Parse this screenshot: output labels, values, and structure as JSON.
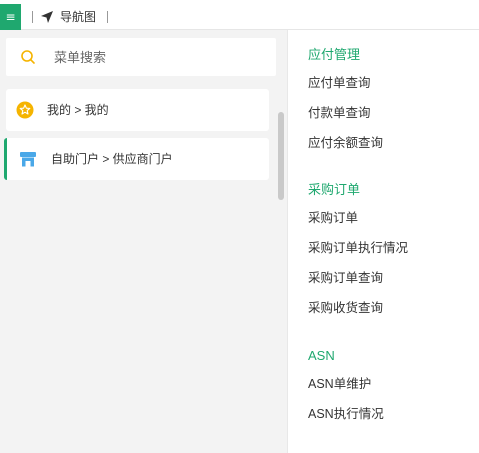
{
  "topbar": {
    "menu_icon": "hamburger-icon",
    "nav_icon": "navigation-arrow-icon",
    "title": "导航图"
  },
  "search": {
    "icon": "search-icon",
    "placeholder": "菜单搜索"
  },
  "favorites": [
    {
      "icon": "star-badge-icon",
      "label": "我的 > 我的"
    },
    {
      "icon": "storefront-icon",
      "label": "自助门户 > 供应商门户"
    }
  ],
  "menu_groups": [
    {
      "title": "应付管理",
      "items": [
        "应付单查询",
        "付款单查询",
        "应付余额查询"
      ]
    },
    {
      "title": "采购订单",
      "items": [
        "采购订单",
        "采购订单执行情况",
        "采购订单查询",
        "采购收货查询"
      ]
    },
    {
      "title": "ASN",
      "items": [
        "ASN单维护",
        "ASN执行情况"
      ]
    }
  ],
  "colors": {
    "accent": "#1fa86f",
    "star_badge": "#f5b400",
    "store_icon": "#4aa8e8"
  }
}
